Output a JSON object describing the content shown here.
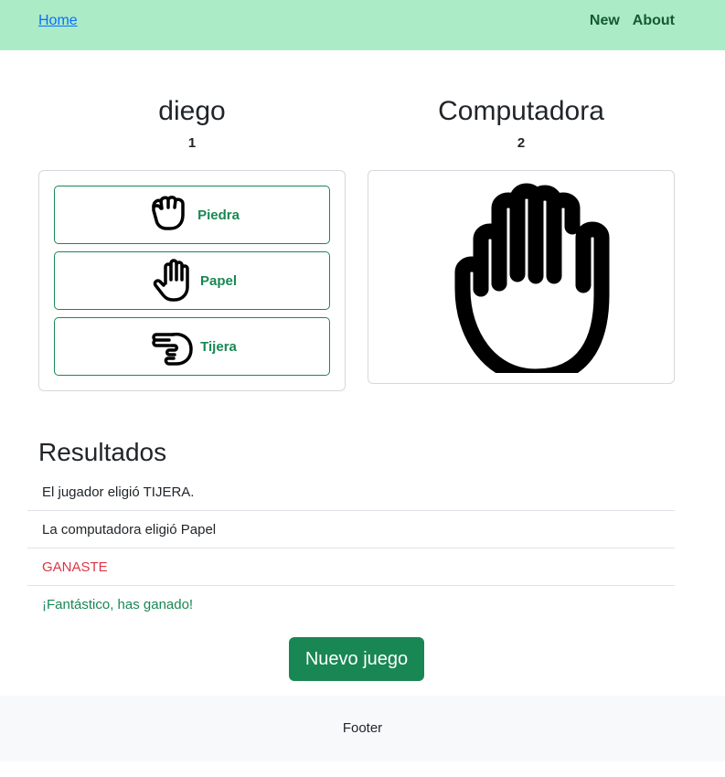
{
  "nav": {
    "home": "Home",
    "new": "New",
    "about": "About"
  },
  "player": {
    "name": "diego",
    "score": "1"
  },
  "computer": {
    "name": "Computadora",
    "score": "2",
    "choice_icon": "hand-paper-icon"
  },
  "choices": [
    {
      "label": "Piedra",
      "icon": "rock-fist-icon"
    },
    {
      "label": "Papel",
      "icon": "paper-hand-icon"
    },
    {
      "label": "Tijera",
      "icon": "scissors-hand-icon"
    }
  ],
  "results": {
    "title": "Resultados",
    "lines": [
      {
        "text": "El jugador eligió TIJERA.",
        "color": "#212529"
      },
      {
        "text": "La computadora eligió Papel",
        "color": "#212529"
      },
      {
        "text": "GANASTE",
        "color": "#dc3545"
      },
      {
        "text": "¡Fantástico, has ganado!",
        "color": "#198754"
      }
    ]
  },
  "new_game_label": "Nuevo juego",
  "footer": "Footer",
  "colors": {
    "navbar": "#abebc6",
    "accent": "#198754",
    "danger": "#dc3545"
  }
}
